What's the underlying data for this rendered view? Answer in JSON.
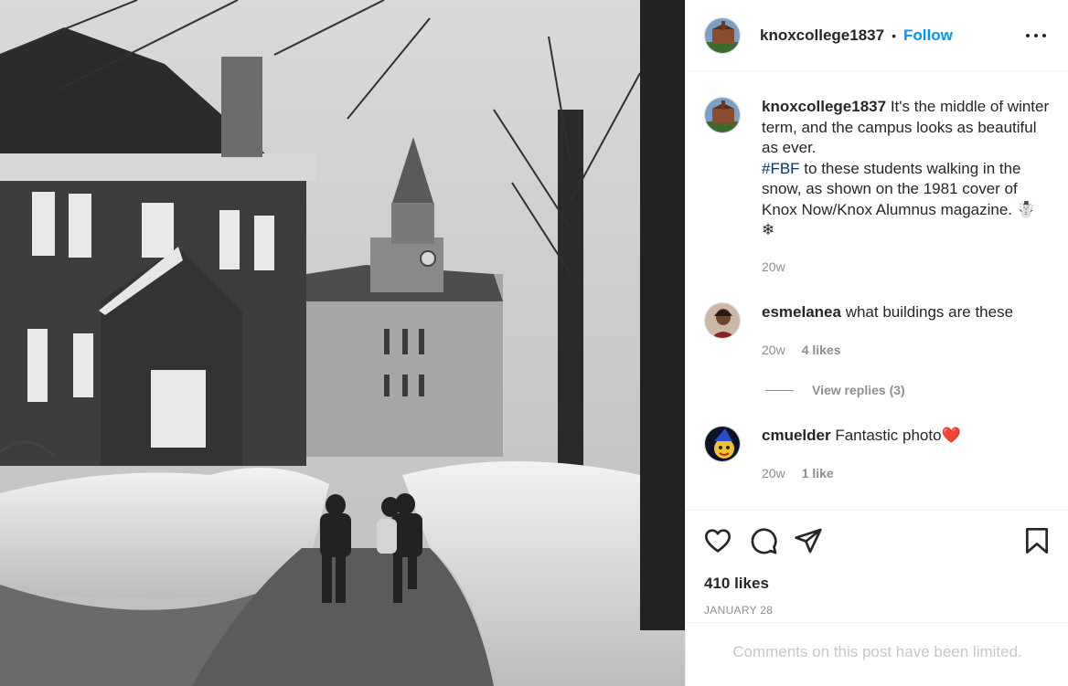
{
  "post": {
    "username": "knoxcollege1837",
    "separator": "•",
    "follow_label": "Follow",
    "more_icon": "more-options-icon"
  },
  "caption": {
    "username": "knoxcollege1837",
    "text_1": "It's the middle of winter term, and the campus looks as beautiful as ever.",
    "hashtag": "#FBF",
    "text_2": "to these students walking in the snow, as shown on the 1981 cover of Knox Now/Knox Alumnus magazine. ☃️ ❄",
    "time": "20w"
  },
  "comments": [
    {
      "username": "esmelanea",
      "text": "what buildings are these",
      "time": "20w",
      "likes": "4 likes"
    },
    {
      "username": "cmuelder",
      "text": "Fantastic photo❤️",
      "time": "20w",
      "likes": "1 like"
    }
  ],
  "view_replies": "View replies (3)",
  "actions": {
    "like_icon": "heart-icon",
    "comment_icon": "comment-icon",
    "share_icon": "send-icon",
    "save_icon": "bookmark-icon"
  },
  "likes_count": "410 likes",
  "date": "JANUARY 28",
  "comments_limited": "Comments on this post have been limited.",
  "colors": {
    "link": "#0095f6",
    "text": "#262626",
    "secondary": "#8e8e8e",
    "heart": "#ed4956"
  }
}
